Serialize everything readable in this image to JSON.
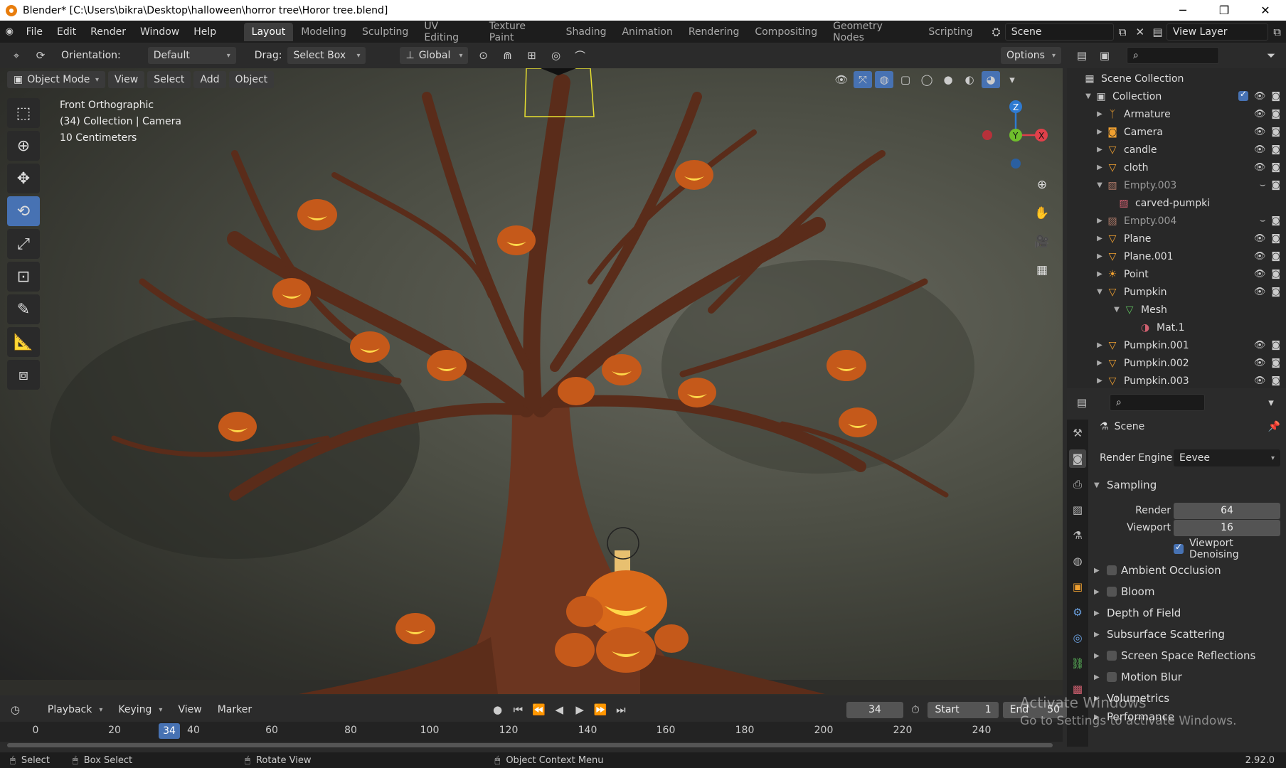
{
  "window": {
    "title": "Blender* [C:\\Users\\bikra\\Desktop\\halloween\\horror tree\\Horor tree.blend]",
    "minimize": "─",
    "restore": "❐",
    "close": "✕"
  },
  "menu": [
    "File",
    "Edit",
    "Render",
    "Window",
    "Help"
  ],
  "workspaces": [
    "Layout",
    "Modeling",
    "Sculpting",
    "UV Editing",
    "Texture Paint",
    "Shading",
    "Animation",
    "Rendering",
    "Compositing",
    "Geometry Nodes",
    "Scripting"
  ],
  "active_workspace": "Layout",
  "scene": {
    "name": "Scene",
    "view_layer": "View Layer"
  },
  "header": {
    "orientation_label": "Orientation:",
    "orientation_value": "Default",
    "drag_label": "Drag:",
    "drag_value": "Select Box",
    "transform_value": "Global",
    "options": "Options"
  },
  "viewport": {
    "mode": "Object Mode",
    "menus": [
      "View",
      "Select",
      "Add",
      "Object"
    ],
    "info": [
      "Front Orthographic",
      "(34) Collection | Camera",
      "10 Centimeters"
    ],
    "gizmo": {
      "z": "Z",
      "y": "Y",
      "x": "X"
    },
    "background_colors": {
      "center": "#67685e",
      "edge": "#222222",
      "trunk": "#6b3520",
      "pumpkin": "#d9691a"
    }
  },
  "outliner": {
    "root": "Scene Collection",
    "collection": "Collection",
    "items": [
      {
        "name": "Armature",
        "dim": false
      },
      {
        "name": "Camera",
        "dim": false
      },
      {
        "name": "candle",
        "dim": false
      },
      {
        "name": "cloth",
        "dim": false
      },
      {
        "name": "Empty.003",
        "dim": true
      },
      {
        "name": "carved-pumpki",
        "dim": false
      },
      {
        "name": "Empty.004",
        "dim": true
      },
      {
        "name": "Plane",
        "dim": false
      },
      {
        "name": "Plane.001",
        "dim": false
      },
      {
        "name": "Point",
        "dim": false
      },
      {
        "name": "Pumpkin",
        "dim": false
      },
      {
        "name": "Mesh",
        "dim": false
      },
      {
        "name": "Mat.1",
        "dim": false
      },
      {
        "name": "Pumpkin.001",
        "dim": false
      },
      {
        "name": "Pumpkin.002",
        "dim": false
      },
      {
        "name": "Pumpkin.003",
        "dim": false
      }
    ]
  },
  "properties": {
    "context": "Scene",
    "render_engine_label": "Render Engine",
    "render_engine": "Eevee",
    "sampling": {
      "title": "Sampling",
      "render_label": "Render",
      "render": "64",
      "viewport_label": "Viewport",
      "viewport": "16",
      "denoise": "Viewport Denoising"
    },
    "sections": [
      "Ambient Occlusion",
      "Bloom",
      "Depth of Field",
      "Subsurface Scattering",
      "Screen Space Reflections",
      "Motion Blur",
      "Volumetrics",
      "Performance"
    ]
  },
  "timeline": {
    "menus": [
      "Playback",
      "Keying",
      "View",
      "Marker"
    ],
    "current_frame": "34",
    "start_label": "Start",
    "start": "1",
    "end_label": "End",
    "end": "50",
    "ticks": [
      "0",
      "20",
      "40",
      "60",
      "80",
      "100",
      "120",
      "140",
      "160",
      "180",
      "200",
      "220",
      "240"
    ]
  },
  "status": {
    "select": "Select",
    "box_select": "Box Select",
    "rotate": "Rotate View",
    "context_menu": "Object Context Menu",
    "version": "2.92.0"
  },
  "watermark": {
    "line1": "Activate Windows",
    "line2": "Go to Settings to activate Windows."
  }
}
